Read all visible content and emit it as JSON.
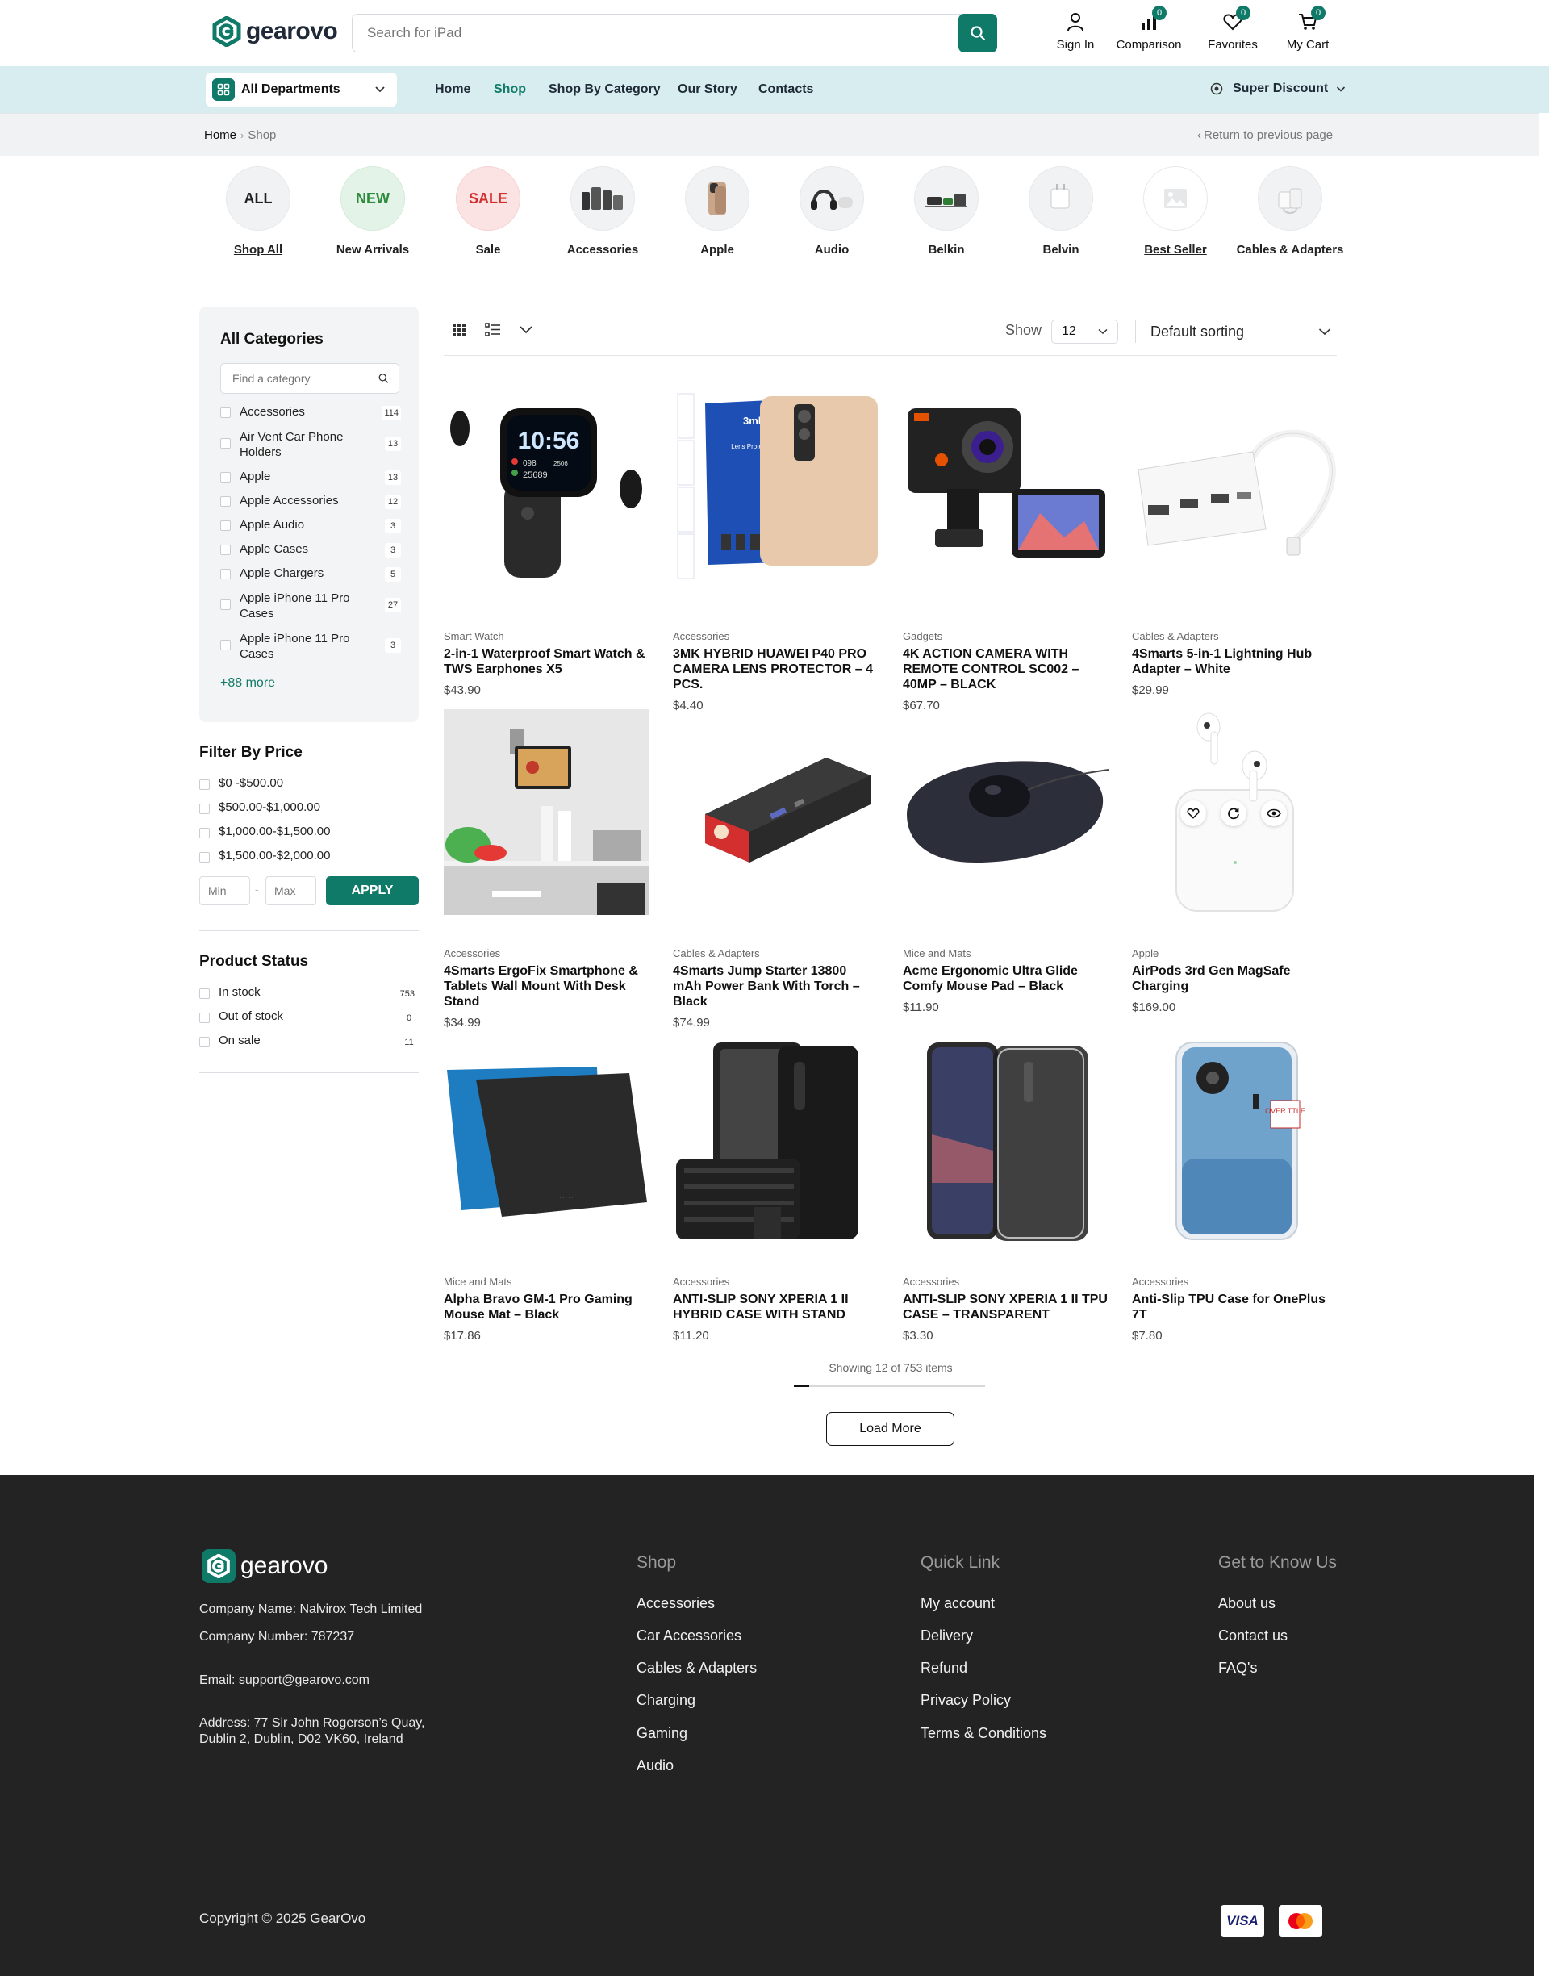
{
  "brand": {
    "name": "gearovo",
    "accent": "#0f7a68"
  },
  "search": {
    "placeholder": "Search for iPad"
  },
  "header_actions": [
    {
      "label": "Sign In",
      "icon": "user-icon",
      "badge": ""
    },
    {
      "label": "Comparison",
      "icon": "bar-chart-icon",
      "badge": "0"
    },
    {
      "label": "Favorites",
      "icon": "heart-icon",
      "badge": "0"
    },
    {
      "label": "My Cart",
      "icon": "cart-icon",
      "badge": "0"
    }
  ],
  "nav": {
    "departments": "All Departments",
    "links": [
      "Home",
      "Shop",
      "Shop By Category",
      "Our Story",
      "Contacts"
    ],
    "active": "Shop",
    "promo": "Super Discount"
  },
  "breadcrumb": {
    "home": "Home",
    "current": "Shop",
    "back": "Return to previous page"
  },
  "category_circles": [
    {
      "badge": "ALL",
      "label": "Shop All"
    },
    {
      "badge": "NEW",
      "label": "New Arrivals"
    },
    {
      "badge": "SALE",
      "label": "Sale"
    },
    {
      "badge": "",
      "label": "Accessories"
    },
    {
      "badge": "",
      "label": "Apple"
    },
    {
      "badge": "",
      "label": "Audio"
    },
    {
      "badge": "",
      "label": "Belkin"
    },
    {
      "badge": "",
      "label": "Belvin"
    },
    {
      "badge": "",
      "label": "Best Seller"
    },
    {
      "badge": "",
      "label": "Cables & Adapters"
    }
  ],
  "sidebar": {
    "title": "All Categories",
    "find_placeholder": "Find a category",
    "categories": [
      {
        "name": "Accessories",
        "count": "114"
      },
      {
        "name": "Air Vent Car Phone Holders",
        "count": "13"
      },
      {
        "name": "Apple",
        "count": "13"
      },
      {
        "name": "Apple Accessories",
        "count": "12"
      },
      {
        "name": "Apple Audio",
        "count": "3"
      },
      {
        "name": "Apple Cases",
        "count": "3"
      },
      {
        "name": "Apple Chargers",
        "count": "5"
      },
      {
        "name": "Apple iPhone 11 Pro Cases",
        "count": "27"
      },
      {
        "name": "Apple iPhone 11 Pro Cases",
        "count": "3"
      }
    ],
    "more": "+88 more",
    "price_title": "Filter By Price",
    "price_ranges": [
      "$0 -$500.00",
      "$500.00-$1,000.00",
      "$1,000.00-$1,500.00",
      "$1,500.00-$2,000.00"
    ],
    "min_placeholder": "Min",
    "max_placeholder": "Max",
    "apply": "APPLY",
    "status_title": "Product Status",
    "statuses": [
      {
        "name": "In stock",
        "count": "753"
      },
      {
        "name": "Out of stock",
        "count": "0"
      },
      {
        "name": "On sale",
        "count": "11"
      }
    ]
  },
  "toolbar": {
    "show_label": "Show",
    "show_value": "12",
    "sort": "Default sorting"
  },
  "products": [
    {
      "category": "Smart Watch",
      "name": "2-in-1 Waterproof Smart Watch & TWS Earphones X5",
      "price": "$43.90",
      "watch_time": "10:56",
      "watch_stats": [
        "098",
        "2506",
        "25689"
      ]
    },
    {
      "category": "Accessories",
      "name": "3MK HYBRID HUAWEI P40 PRO CAMERA LENS PROTECTOR – 4 PCS.",
      "price": "$4.40",
      "pack_brand": "3mk",
      "pack_text": "Lens Protection"
    },
    {
      "category": "Gadgets",
      "name": "4K ACTION CAMERA WITH REMOTE CONTROL SC002 – 40MP – BLACK",
      "price": "$67.70"
    },
    {
      "category": "Cables & Adapters",
      "name": "4Smarts 5-in-1 Lightning Hub Adapter – White",
      "price": "$29.99"
    },
    {
      "category": "Accessories",
      "name": "4Smarts ErgoFix Smartphone & Tablets Wall Mount With Desk Stand",
      "price": "$34.99"
    },
    {
      "category": "Cables & Adapters",
      "name": "4Smarts Jump Starter 13800 mAh Power Bank With Torch – Black",
      "price": "$74.99"
    },
    {
      "category": "Mice and Mats",
      "name": "Acme Ergonomic Ultra Glide Comfy Mouse Pad – Black",
      "price": "$11.90"
    },
    {
      "category": "Apple",
      "name": "AirPods 3rd Gen MagSafe Charging",
      "price": "$169.00"
    },
    {
      "category": "Mice and Mats",
      "name": "Alpha Bravo GM-1 Pro Gaming Mouse Mat – Black",
      "price": "$17.86"
    },
    {
      "category": "Accessories",
      "name": "ANTI-SLIP SONY XPERIA 1 II HYBRID CASE WITH STAND",
      "price": "$11.20"
    },
    {
      "category": "Accessories",
      "name": "ANTI-SLIP SONY XPERIA 1 II TPU CASE – TRANSPARENT",
      "price": "$3.30"
    },
    {
      "category": "Accessories",
      "name": "Anti-Slip TPU Case for OnePlus 7T",
      "price": "$7.80",
      "case_text": "OVER TTLE"
    }
  ],
  "pagination": {
    "showing": "Showing 12 of 753 items",
    "progress": 0.08,
    "load_more": "Load More"
  },
  "footer": {
    "company_name": "Company Name: Nalvirox Tech Limited",
    "company_number": "Company Number: 787237",
    "email": "Email: support@gearovo.com",
    "address_line1": "Address: 77 Sir John Rogerson’s Quay,",
    "address_line2": "Dublin 2, Dublin, D02 VK60, Ireland",
    "shop_title": "Shop",
    "shop_links": [
      "Accessories",
      "Car Accessories",
      "Cables & Adapters",
      "Charging",
      "Gaming",
      "Audio"
    ],
    "quick_title": "Quick Link",
    "quick_links": [
      "My account",
      "Delivery",
      "Refund",
      "Privacy Policy",
      "Terms & Conditions"
    ],
    "know_title": "Get to Know Us",
    "know_links": [
      "About us",
      "Contact us",
      "FAQ's"
    ],
    "copyright": "Copyright © 2025 GearOvo",
    "payments": [
      "VISA",
      "Mastercard"
    ]
  }
}
